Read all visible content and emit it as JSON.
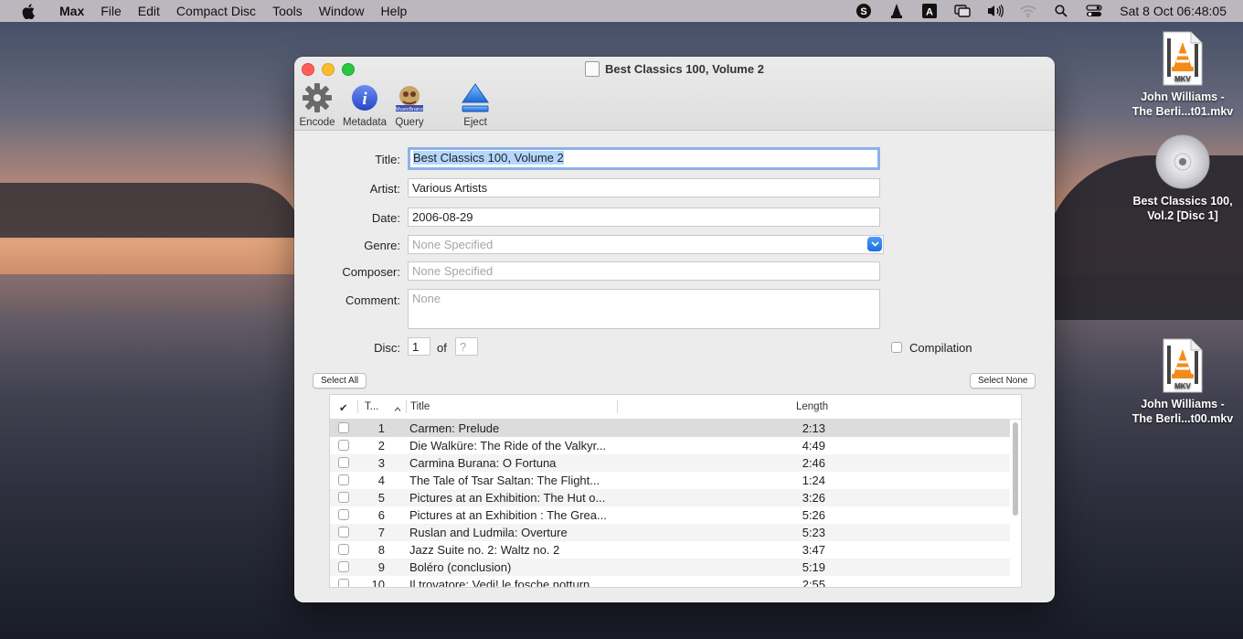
{
  "menubar": {
    "app": "Max",
    "items": [
      "File",
      "Edit",
      "Compact Disc",
      "Tools",
      "Window",
      "Help"
    ],
    "clock": "Sat 8 Oct  06:48:05",
    "status_icons": [
      "skype-icon",
      "vlc-icon",
      "text-input-icon",
      "screen-mirroring-icon",
      "volume-icon",
      "wifi-icon",
      "search-icon",
      "control-center-icon"
    ]
  },
  "desktop": {
    "icons": [
      {
        "label_line1": "John Williams -",
        "label_line2": "The Berli...t01.mkv",
        "badge": "MKV"
      },
      {
        "label_line1": "Best Classics 100,",
        "label_line2": "Vol.2 [Disc 1]"
      },
      {
        "label_line1": "John Williams -",
        "label_line2": "The Berli...t00.mkv",
        "badge": "MKV"
      }
    ]
  },
  "window": {
    "title": "Best Classics 100, Volume 2",
    "toolbar": {
      "encode": "Encode",
      "metadata": "Metadata",
      "query": "Query",
      "eject": "Eject"
    },
    "form": {
      "title_label": "Title:",
      "title_value": "Best Classics 100, Volume 2",
      "artist_label": "Artist:",
      "artist_value": "Various Artists",
      "date_label": "Date:",
      "date_value": "2006-08-29",
      "genre_label": "Genre:",
      "genre_placeholder": "None Specified",
      "composer_label": "Composer:",
      "composer_placeholder": "None Specified",
      "comment_label": "Comment:",
      "comment_placeholder": "None",
      "disc_label": "Disc:",
      "disc_value": "1",
      "of_label": "of",
      "disc_total_placeholder": "?",
      "compilation_label": "Compilation"
    },
    "select_all": "Select All",
    "select_none": "Select None",
    "table": {
      "columns": {
        "check": "✔",
        "track": "T...",
        "title": "Title",
        "length": "Length"
      },
      "rows": [
        {
          "num": "1",
          "title": "Carmen: Prelude",
          "length": "2:13"
        },
        {
          "num": "2",
          "title": "Die Walküre: The Ride of the Valkyr...",
          "length": "4:49"
        },
        {
          "num": "3",
          "title": "Carmina Burana: O Fortuna",
          "length": "2:46"
        },
        {
          "num": "4",
          "title": "The Tale of Tsar Saltan: The Flight...",
          "length": "1:24"
        },
        {
          "num": "5",
          "title": "Pictures at an Exhibition: The Hut o...",
          "length": "3:26"
        },
        {
          "num": "6",
          "title": "Pictures at an Exhibition : The Grea...",
          "length": "5:26"
        },
        {
          "num": "7",
          "title": "Ruslan and Ludmila: Overture",
          "length": "5:23"
        },
        {
          "num": "8",
          "title": "Jazz Suite no. 2: Waltz no. 2",
          "length": "3:47"
        },
        {
          "num": "9",
          "title": "Boléro (conclusion)",
          "length": "5:19"
        },
        {
          "num": "10",
          "title": "Il trovatore: Vedi! le fosche notturn...",
          "length": "2:55"
        }
      ]
    }
  }
}
